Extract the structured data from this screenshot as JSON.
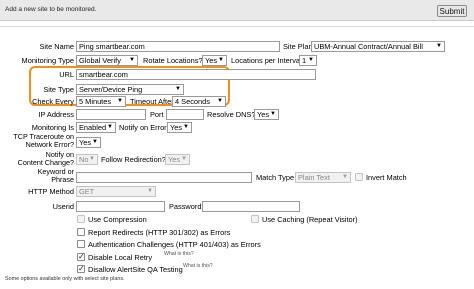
{
  "header": {
    "title": "Add a new site to be monitored.",
    "submit_label": "Submit"
  },
  "form": {
    "site_name_label": "Site Name",
    "site_name_value": "Ping smartbear.com",
    "site_plan_label": "Site Plan",
    "site_plan_value": "UBM-Annual Contract/Annual Bill",
    "monitoring_type_label": "Monitoring Type",
    "monitoring_type_value": "Global Verify",
    "rotate_locations_label": "Rotate Locations?",
    "rotate_locations_value": "Yes",
    "locations_per_interval_label": "Locations per Interval",
    "locations_per_interval_value": "1",
    "url_label": "URL",
    "url_value": "smartbear.com",
    "site_type_label": "Site Type",
    "site_type_value": "Server/Device Ping",
    "check_every_label": "Check Every",
    "check_every_value": "5 Minutes",
    "timeout_after_label": "Timeout After",
    "timeout_after_value": "4 Seconds",
    "ip_address_label": "IP Address",
    "ip_address_value": "",
    "port_label": "Port",
    "port_value": "",
    "resolve_dns_label": "Resolve DNS?",
    "resolve_dns_value": "Yes",
    "monitoring_is_label": "Monitoring Is",
    "monitoring_is_value": "Enabled",
    "notify_on_error_label": "Notify on Error?",
    "notify_on_error_value": "Yes",
    "tcp_traceroute_label_1": "TCP Traceroute on",
    "tcp_traceroute_label_2": "Network Error?",
    "tcp_traceroute_value": "Yes",
    "notify_content_change_label_1": "Notify on",
    "notify_content_change_label_2": "Content Change?",
    "notify_content_change_value": "No",
    "follow_redirection_label": "Follow Redirection?",
    "follow_redirection_value": "Yes",
    "keyword_label_1": "Keyword or",
    "keyword_label_2": "Phrase",
    "keyword_value": "",
    "match_type_label": "Match Type",
    "match_type_value": "Plain Text",
    "invert_match_label": "Invert Match",
    "http_method_label": "HTTP Method",
    "http_method_value": "GET",
    "userid_label": "Userid",
    "userid_value": "",
    "password_label": "Password",
    "password_value": "",
    "use_compression_label": "Use Compression",
    "use_caching_label": "Use Caching (Repeat Visitor)",
    "report_redirects_label": "Report Redirects (HTTP 301/302) as Errors",
    "auth_challenges_label": "Authentication Challenges (HTTP 401/403) as Errors",
    "disable_local_retry_label": "Disable Local Retry",
    "disable_alertsite_qa_label": "Disallow AlertSite QA Testing",
    "what_is_this": "What is this?"
  },
  "footer": {
    "note": "Some options available only with select site plans."
  }
}
